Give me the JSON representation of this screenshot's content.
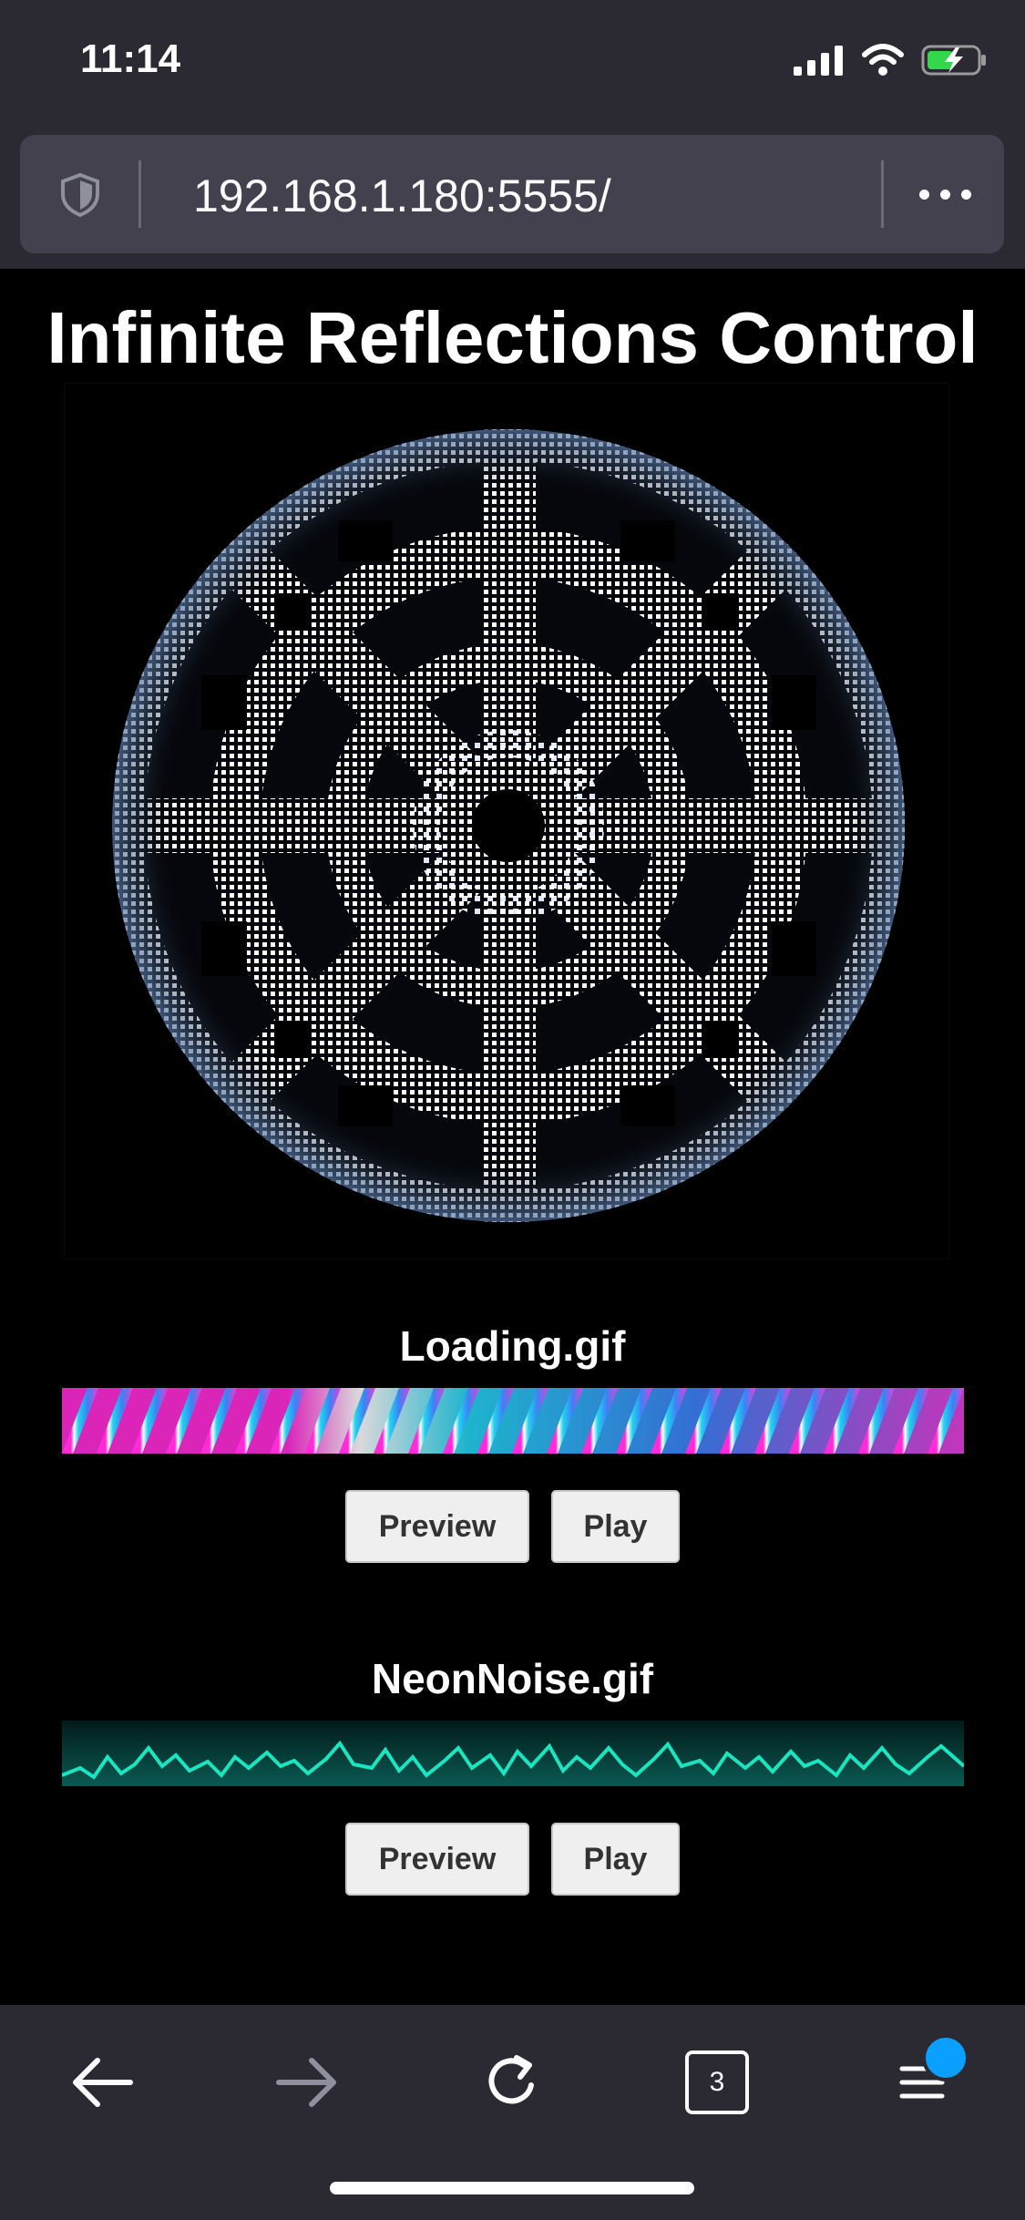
{
  "status_bar": {
    "time": "11:14"
  },
  "browser": {
    "url": "192.168.1.180:5555/",
    "tab_count": "3",
    "icons": [
      "shield-icon",
      "more-icon",
      "back-icon",
      "forward-icon",
      "reload-icon",
      "tabs-icon",
      "menu-icon"
    ]
  },
  "page": {
    "title": "Infinite Reflections Control",
    "gifs": [
      {
        "name": "Loading.gif",
        "preview_label": "Preview",
        "play_label": "Play"
      },
      {
        "name": "NeonNoise.gif",
        "preview_label": "Preview",
        "play_label": "Play"
      }
    ]
  },
  "colors": {
    "chrome_bg": "#2b2a33",
    "url_bar_bg": "#42414d",
    "accent_blue": "#0aa0ff",
    "magenta": "#ff2bd6",
    "cyan": "#22d3ee",
    "neon_teal": "#19e6c1"
  }
}
